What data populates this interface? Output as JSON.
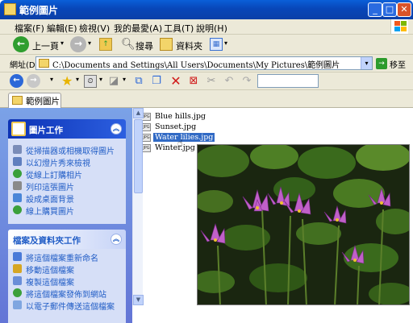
{
  "window": {
    "title": "範例圖片",
    "minimize": "_",
    "maximize": "□",
    "close": "✕"
  },
  "menu": [
    "檔案(F)",
    "編輯(E)",
    "檢視(V)",
    "我的最愛(A)",
    "工具(T)",
    "說明(H)"
  ],
  "toolbar": {
    "back_label": "上一頁",
    "search_label": "搜尋",
    "folders_label": "資料夾"
  },
  "address": {
    "label": "網址(D)",
    "path": "C:\\Documents and Settings\\All Users\\Documents\\My Pictures\\範例圖片",
    "go_label": "移至"
  },
  "tab": {
    "label": "範例圖片"
  },
  "picture_tasks": {
    "title": "圖片工作",
    "items": [
      "從掃描器或相機取得圖片",
      "以幻燈片秀來檢視",
      "從線上訂購相片",
      "列印這張圖片",
      "設成桌面背景",
      "線上購買圖片"
    ]
  },
  "file_tasks": {
    "title": "檔案及資料夾工作",
    "items": [
      "將這個檔案重新命名",
      "移動這個檔案",
      "複製這個檔案",
      "將這個檔案發佈到網站",
      "以電子郵件傳送這個檔案"
    ]
  },
  "files": [
    {
      "name": "Blue hills.jpg",
      "selected": false
    },
    {
      "name": "Sunset.jpg",
      "selected": false
    },
    {
      "name": "Water lilies.jpg",
      "selected": true
    },
    {
      "name": "Winter.jpg",
      "selected": false
    }
  ],
  "colors": {
    "title_blue": "#0a5fd8",
    "task_blue": "#215dc6",
    "selection": "#316ac5",
    "chrome": "#ece9d8"
  }
}
